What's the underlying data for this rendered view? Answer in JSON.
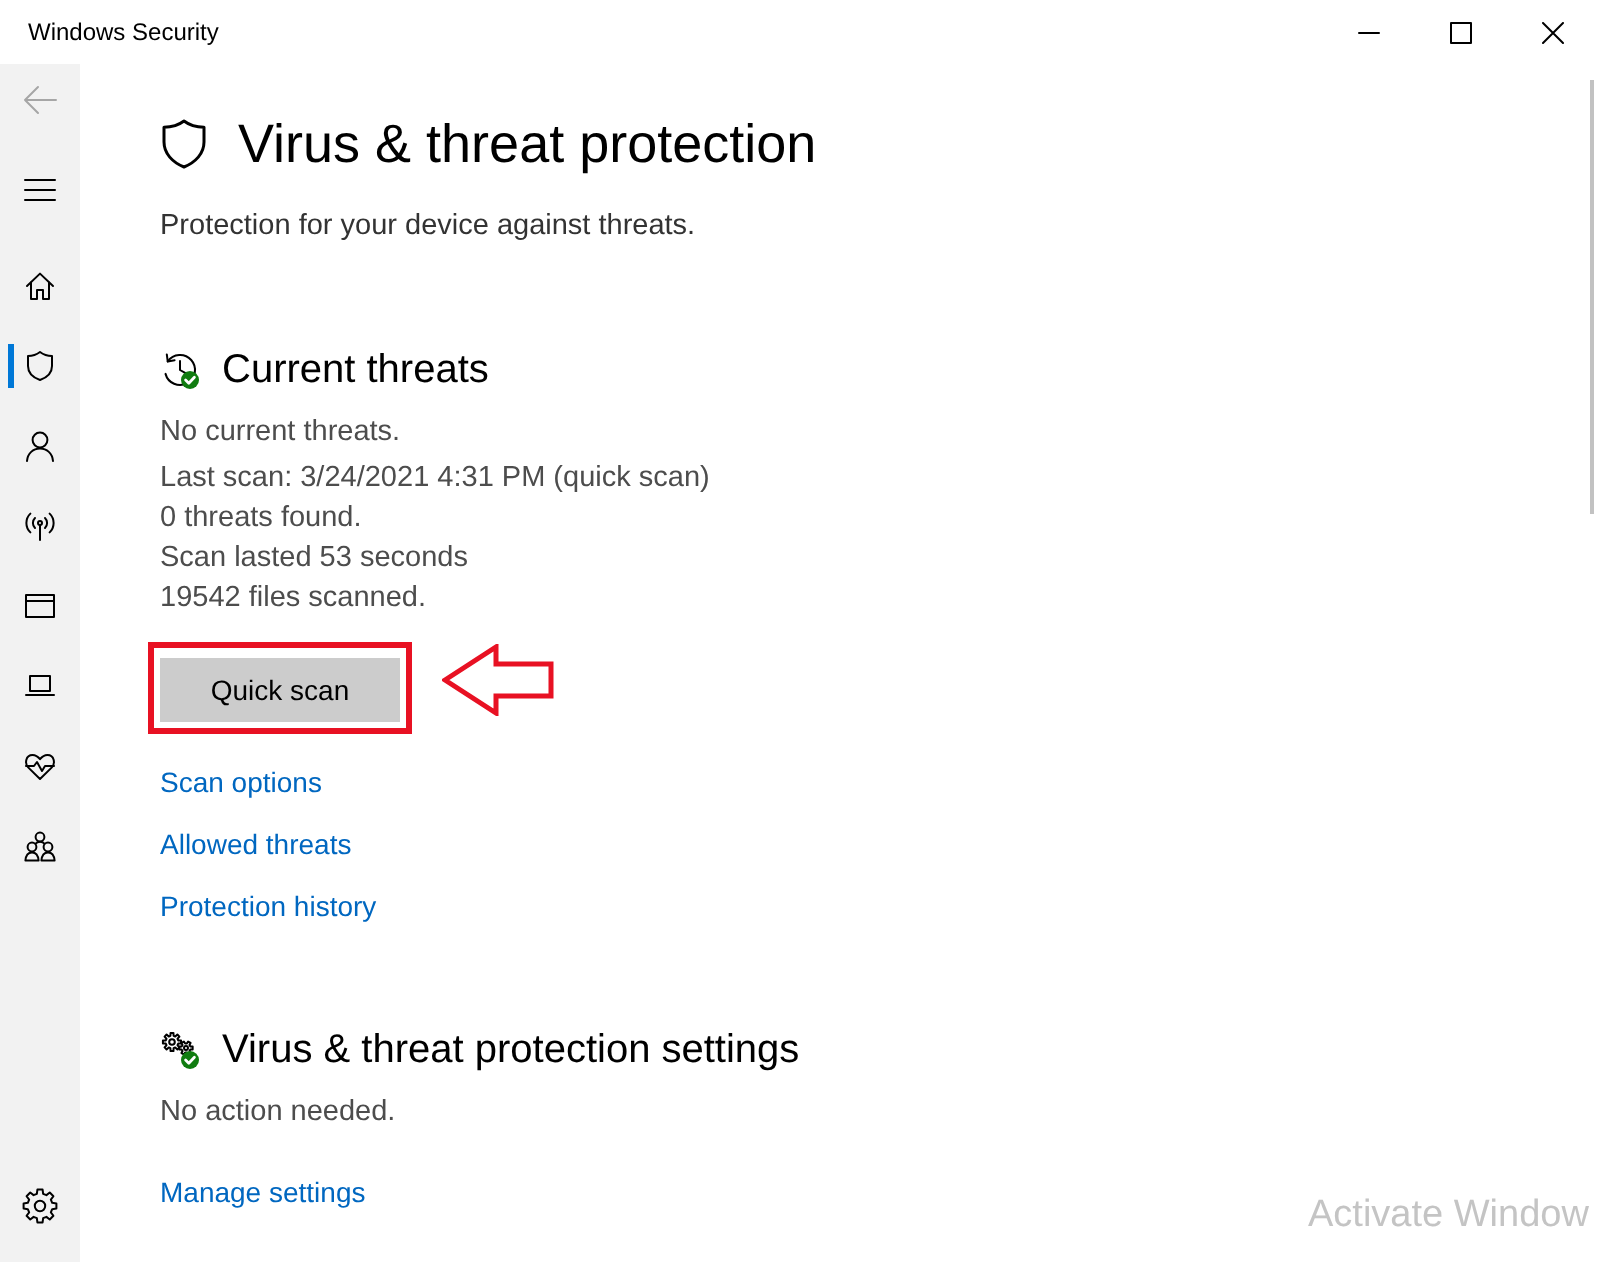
{
  "window": {
    "title": "Windows Security"
  },
  "sidebar": {
    "back": {
      "disabled": true
    },
    "items": [
      {
        "selected": false
      },
      {
        "selected": true
      },
      {
        "selected": false
      },
      {
        "selected": false
      },
      {
        "selected": false
      },
      {
        "selected": false
      },
      {
        "selected": false
      },
      {
        "selected": false
      }
    ],
    "settings": {
      "selected": false
    }
  },
  "page": {
    "title": "Virus & threat protection",
    "subtitle": "Protection for your device against threats."
  },
  "sections": [
    {
      "kind": "current-threats",
      "protected": true,
      "heading": "Current threats",
      "summary": "No current threats.",
      "details": [
        "Last scan: 3/24/2021 4:31 PM (quick scan)",
        "0 threats found.",
        "Scan lasted 53 seconds",
        "19542 files scanned."
      ],
      "button": {
        "label": "Quick scan",
        "highlighted": true,
        "pointed_at": true
      },
      "links": [
        "Scan options",
        "Allowed threats",
        "Protection history"
      ]
    },
    {
      "kind": "protection-settings",
      "protected": true,
      "heading": "Virus & threat protection settings",
      "summary": "No action needed.",
      "links": [
        "Manage settings"
      ]
    }
  ],
  "activation_notice": {
    "title": "Activate Window"
  }
}
